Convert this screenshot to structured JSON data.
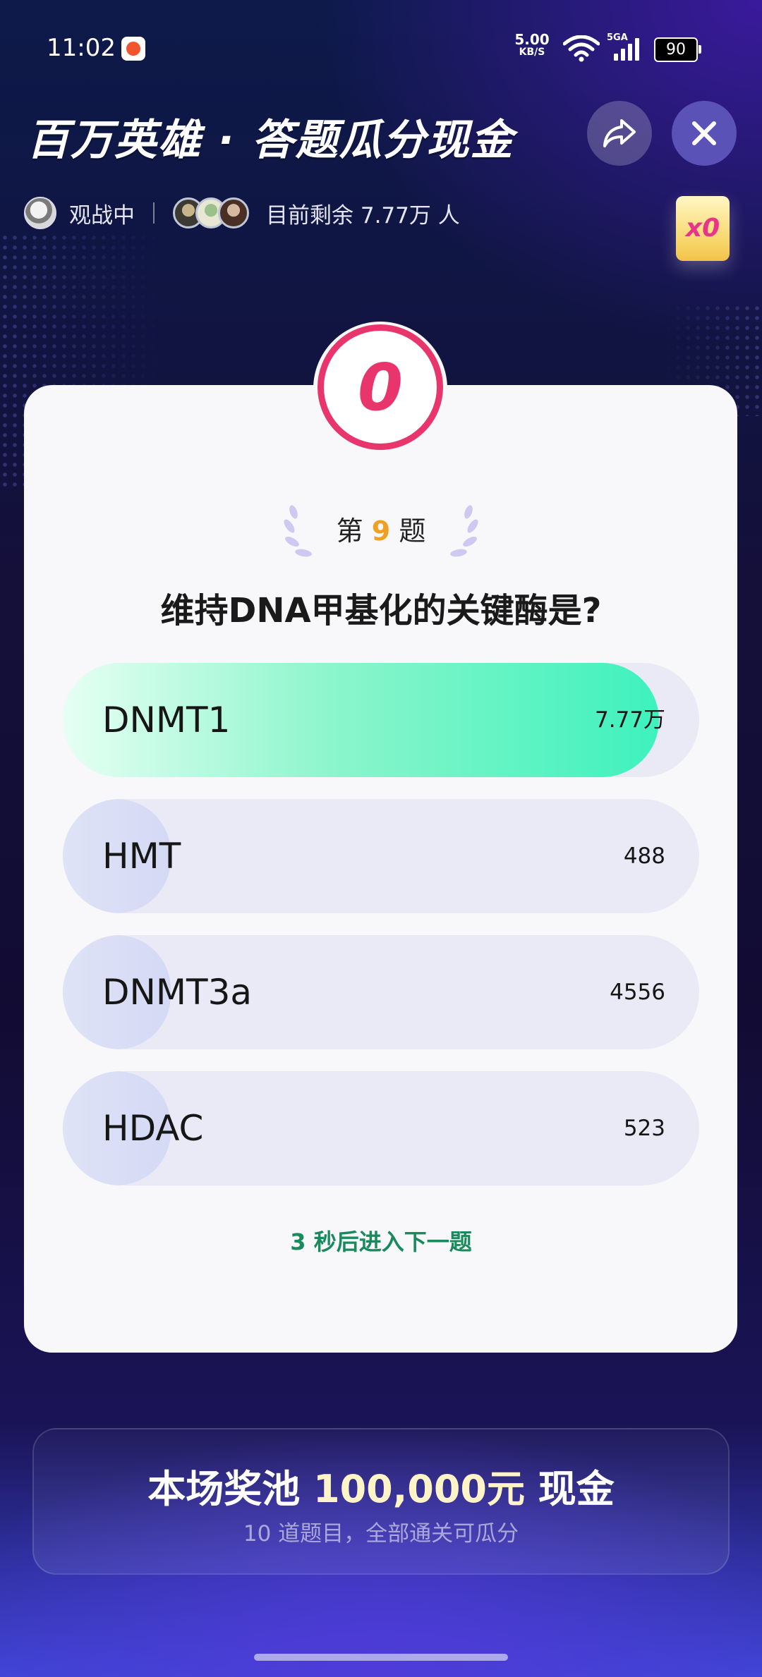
{
  "status_bar": {
    "time": "11:02",
    "net_speed": "5.00",
    "net_unit": "KB/S",
    "signal_label": "5GA",
    "battery": "90"
  },
  "header": {
    "title": "百万英雄 · 答题瓜分现金",
    "watching": "观战中",
    "remaining": "目前剩余 7.77万 人",
    "card_count": "x0"
  },
  "card": {
    "score": "0",
    "question_prefix": "第",
    "question_number": "9",
    "question_suffix": "题",
    "question": "维持DNA甲基化的关键酶是?",
    "options": [
      {
        "label": "DNMT1",
        "count": "7.77万",
        "share": 0.937,
        "correct": true
      },
      {
        "label": "HMT",
        "count": "488",
        "share": 0.17,
        "correct": false
      },
      {
        "label": "DNMT3a",
        "count": "4556",
        "share": 0.17,
        "correct": false
      },
      {
        "label": "HDAC",
        "count": "523",
        "share": 0.17,
        "correct": false
      }
    ],
    "countdown": "3 秒后进入下一题"
  },
  "prize": {
    "prefix": "本场奖池",
    "amount": "100,000元",
    "suffix": "现金",
    "subtitle": "10 道题目，全部通关可瓜分"
  },
  "colors": {
    "accent_red": "#e8356b",
    "correct_green": "#3ef2bd",
    "countdown_green": "#1a8a5c",
    "number_orange": "#f0a020"
  }
}
